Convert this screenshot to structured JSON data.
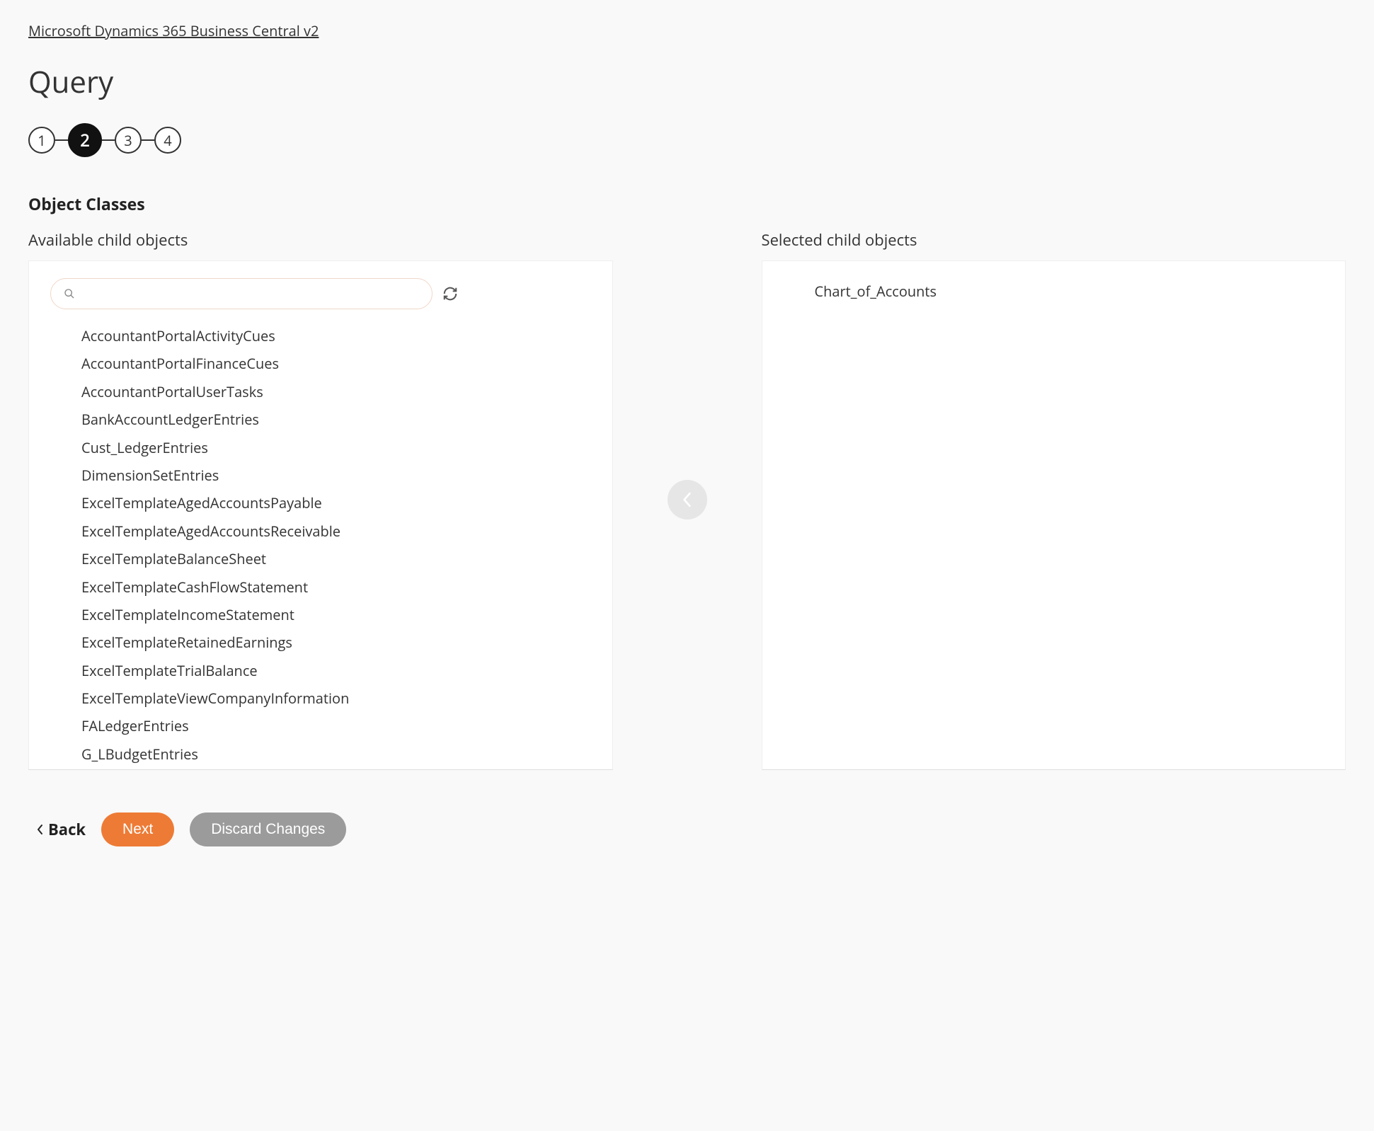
{
  "breadcrumb": "Microsoft Dynamics 365 Business Central v2",
  "page_title": "Query",
  "stepper": {
    "steps": [
      "1",
      "2",
      "3",
      "4"
    ],
    "active_index": 1
  },
  "section_title": "Object Classes",
  "available": {
    "title": "Available child objects",
    "search_placeholder": "",
    "items": [
      "AccountantPortalActivityCues",
      "AccountantPortalFinanceCues",
      "AccountantPortalUserTasks",
      "BankAccountLedgerEntries",
      "Cust_LedgerEntries",
      "DimensionSetEntries",
      "ExcelTemplateAgedAccountsPayable",
      "ExcelTemplateAgedAccountsReceivable",
      "ExcelTemplateBalanceSheet",
      "ExcelTemplateCashFlowStatement",
      "ExcelTemplateIncomeStatement",
      "ExcelTemplateRetainedEarnings",
      "ExcelTemplateTrialBalance",
      "ExcelTemplateViewCompanyInformation",
      "FALedgerEntries",
      "G_LBudgetEntries"
    ]
  },
  "selected": {
    "title": "Selected child objects",
    "items": [
      "Chart_of_Accounts"
    ]
  },
  "footer": {
    "back": "Back",
    "next": "Next",
    "discard": "Discard Changes"
  }
}
